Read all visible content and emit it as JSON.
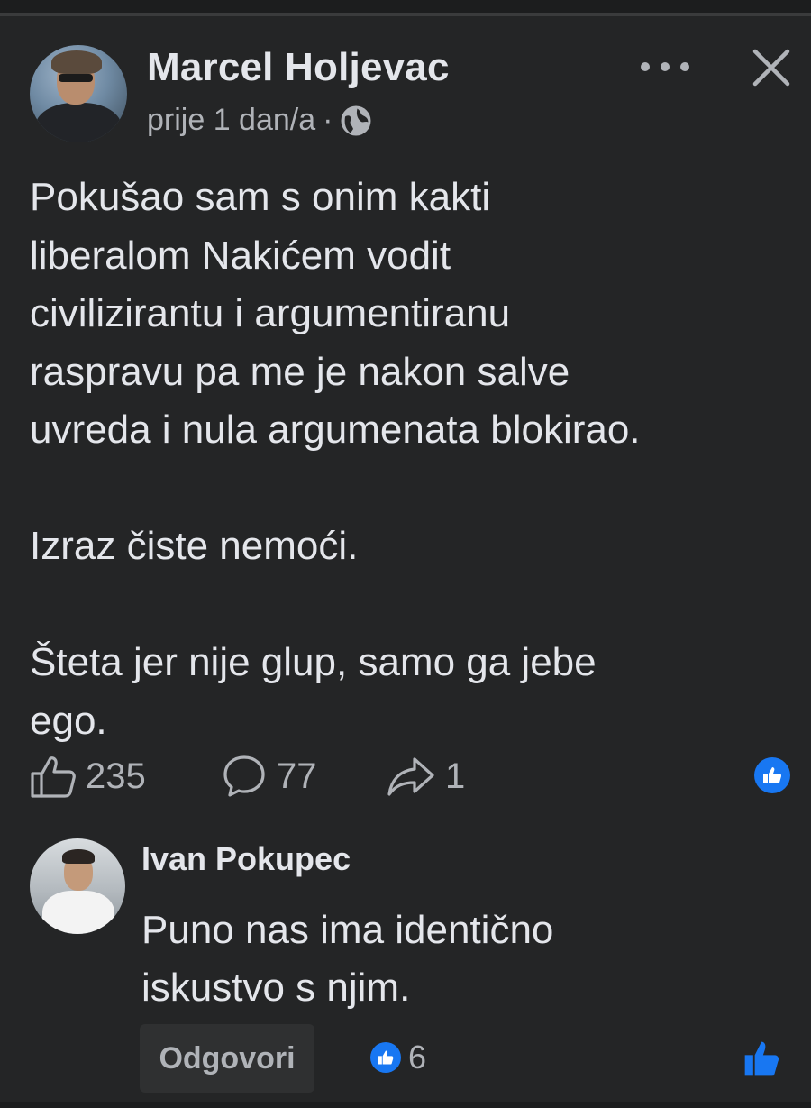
{
  "post": {
    "author": "Marcel Holjevac",
    "time": "prije 1 dan/a",
    "separator": "·",
    "privacy_icon": "globe-icon",
    "text": "Pokušao sam s onim kakti\nliberalom Nakićem vodit\ncivilizirantu i argumentiranu\nraspravu pa me je nakon salve\nuvreda i nula argumenata blokirao.\n\nIzraz čiste nemoći.\n\nŠteta jer nije glup, samo ga jebe\nego.",
    "likes": "235",
    "comments": "77",
    "shares": "1"
  },
  "comment": {
    "author": "Ivan Pokupec",
    "text": "Puno nas ima identično\niskustvo s njim.",
    "reply_label": "Odgovori",
    "reactions": "6"
  },
  "colors": {
    "background": "#242526",
    "text": "#e4e6eb",
    "secondary": "#b0b3b8",
    "accent": "#1877f2"
  }
}
